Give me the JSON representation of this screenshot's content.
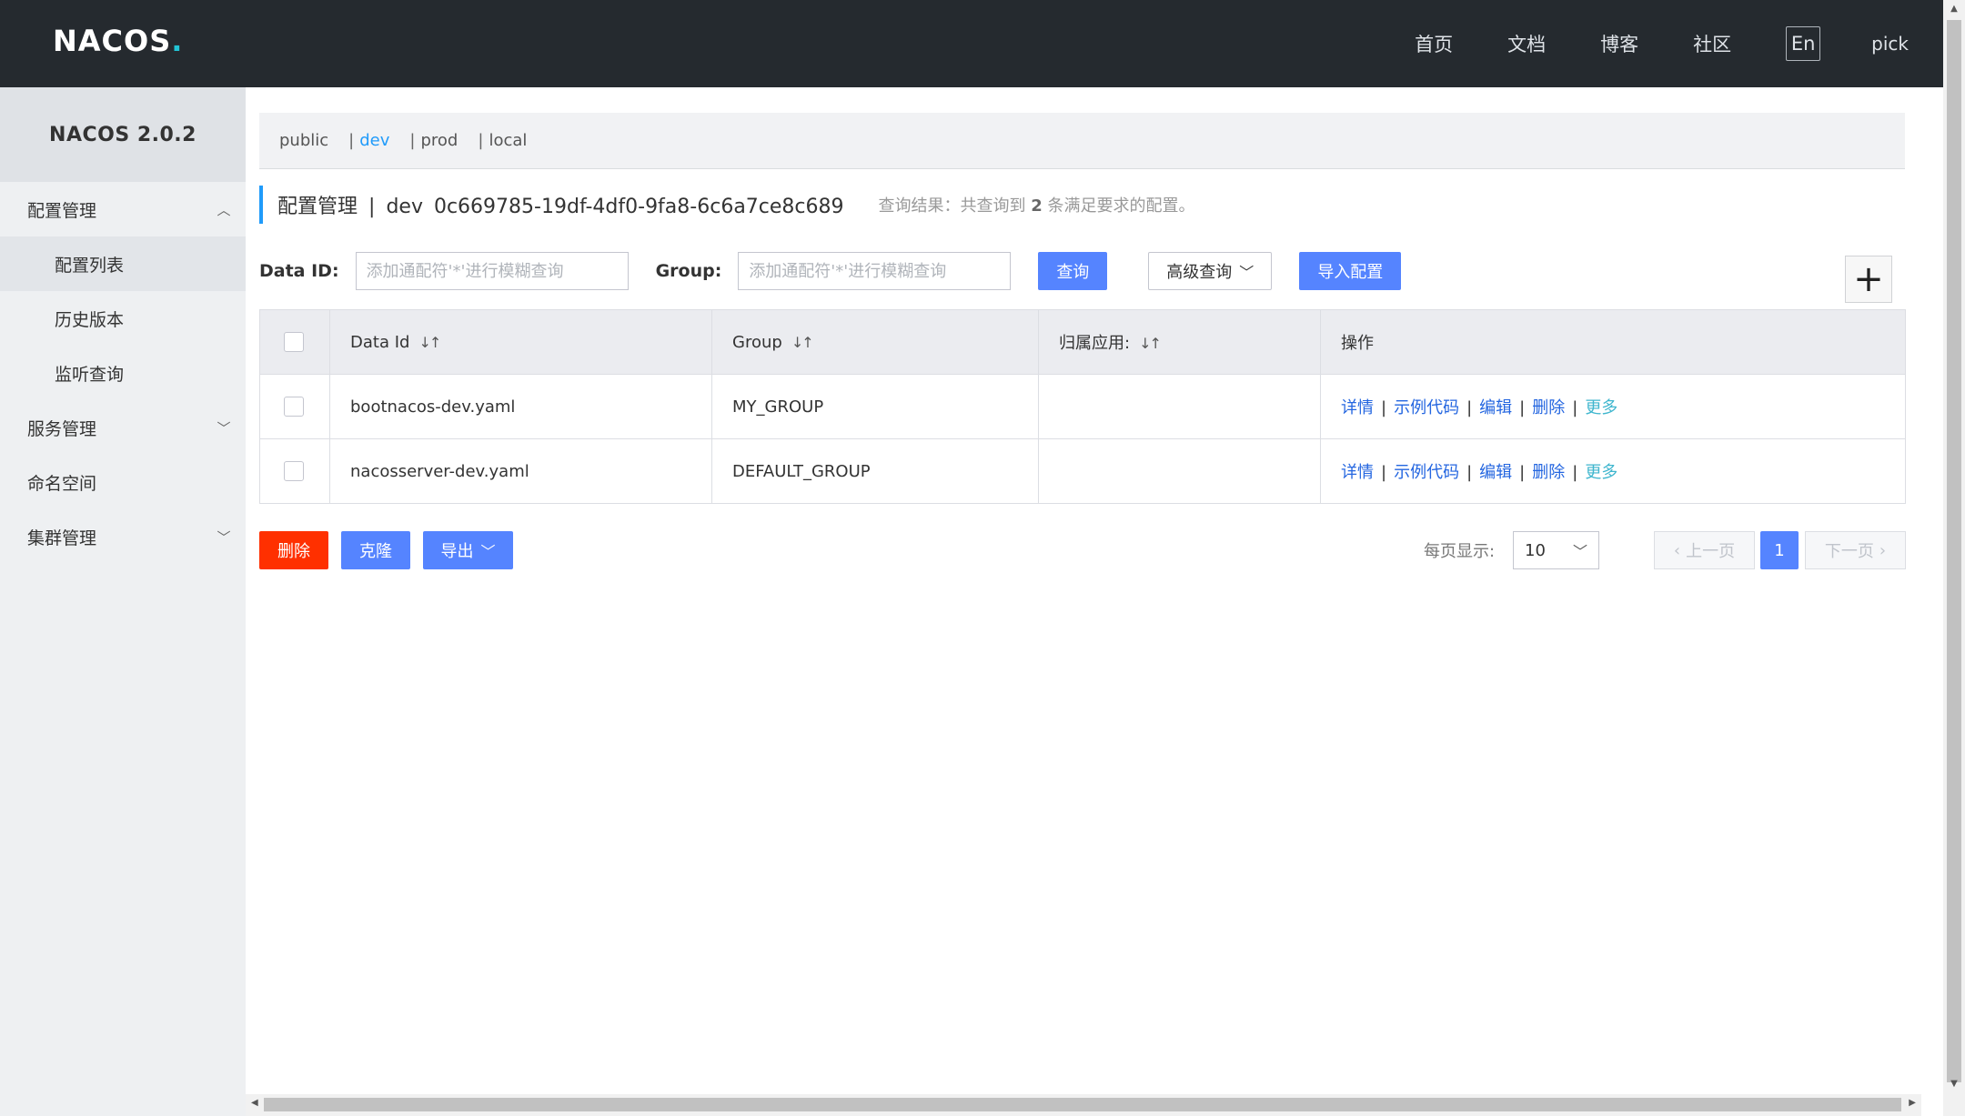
{
  "header": {
    "logo_text": "NACOS",
    "logo_dot": ".",
    "nav": [
      "首页",
      "文档",
      "博客",
      "社区"
    ],
    "lang": "En",
    "user": "pick"
  },
  "sidebar": {
    "title": "NACOS 2.0.2",
    "groups": [
      {
        "label": "配置管理",
        "expanded": true,
        "items": [
          "配置列表",
          "历史版本",
          "监听查询"
        ]
      },
      {
        "label": "服务管理",
        "expanded": false
      },
      {
        "label": "命名空间"
      },
      {
        "label": "集群管理",
        "expanded": false
      }
    ],
    "active_item": "配置列表"
  },
  "namespaces": {
    "items": [
      "public",
      "dev",
      "prod",
      "local"
    ],
    "active": "dev",
    "active_color": "#209bfa"
  },
  "page": {
    "title": "配置管理",
    "separator": "|",
    "namespace": "dev",
    "namespace_id": "0c669785-19df-4df0-9fa8-6c6a7ce8c689",
    "result_prefix": "查询结果：共查询到",
    "result_count": "2",
    "result_suffix": "条满足要求的配置。"
  },
  "search": {
    "data_id_label": "Data ID:",
    "data_id_placeholder": "添加通配符'*'进行模糊查询",
    "group_label": "Group:",
    "group_placeholder": "添加通配符'*'进行模糊查询",
    "query_button": "查询",
    "advanced_button": "高级查询",
    "import_button": "导入配置",
    "add_button": "+"
  },
  "table": {
    "columns": [
      "Data Id",
      "Group",
      "归属应用:",
      "操作"
    ],
    "rows": [
      {
        "data_id": "bootnacos-dev.yaml",
        "group": "MY_GROUP",
        "app": ""
      },
      {
        "data_id": "nacosserver-dev.yaml",
        "group": "DEFAULT_GROUP",
        "app": ""
      }
    ],
    "actions": [
      "详情",
      "示例代码",
      "编辑",
      "删除",
      "更多"
    ],
    "action_sep": "|"
  },
  "footer": {
    "delete_button": "删除",
    "clone_button": "克隆",
    "export_button": "导出",
    "page_size_label": "每页显示:",
    "page_size": "10",
    "prev": "上一页",
    "current_page": "1",
    "next": "下一页"
  },
  "colors": {
    "primary": "#5584ff",
    "danger": "#ff3000",
    "link": "#2466e0",
    "more_link": "#3fb6ce",
    "topbar": "#252a2f"
  }
}
